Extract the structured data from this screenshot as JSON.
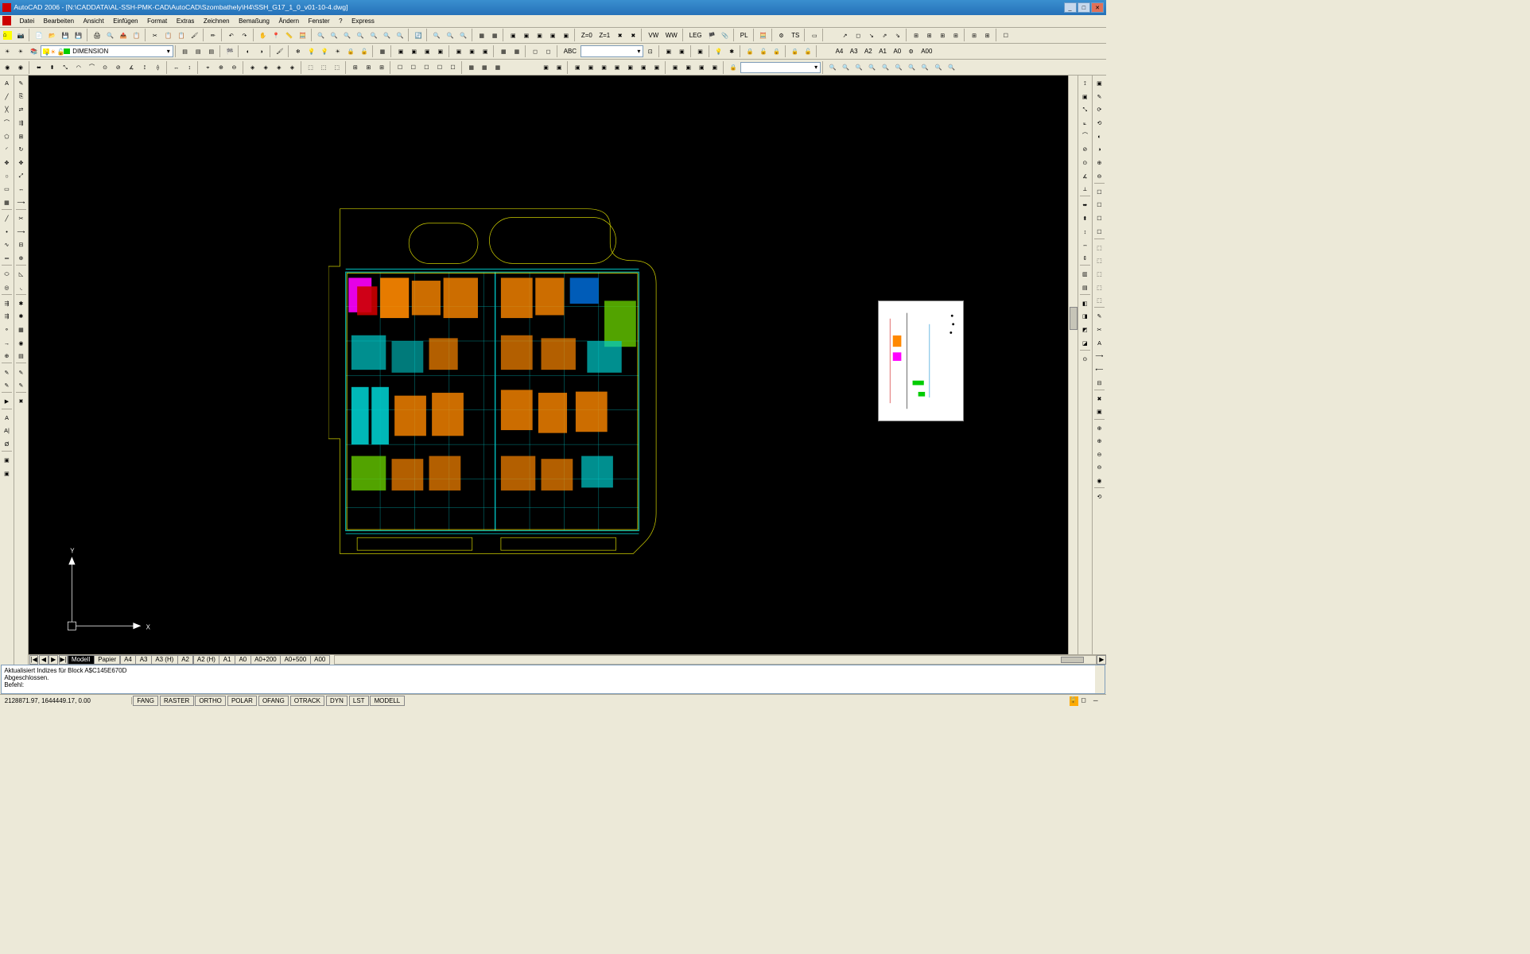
{
  "title": "AutoCAD 2006 - [N:\\CADDATA\\AL-SSH-PMK-CAD\\AutoCAD\\Szombathely\\H4\\SSH_G17_1_0_v01-10-4.dwg]",
  "menu": [
    "Datei",
    "Bearbeiten",
    "Ansicht",
    "Einfügen",
    "Format",
    "Extras",
    "Zeichnen",
    "Bemaßung",
    "Ändern",
    "Fenster",
    "?",
    "Express"
  ],
  "layer": {
    "name": "DIMENSION"
  },
  "paper_sizes": [
    "A4",
    "A3",
    "A2",
    "A1",
    "A0",
    "A00"
  ],
  "tool_text": {
    "z0": "Z=0",
    "z1": "Z=1",
    "vw": "VW",
    "ww": "WW",
    "leg": "LEG",
    "pl": "PL",
    "ts": "TS"
  },
  "tabs": {
    "nav": [
      "|◀",
      "◀",
      "▶",
      "▶|"
    ],
    "items": [
      "Modell",
      "Papier",
      "A4",
      "A3",
      "A3 (H)",
      "A2",
      "A2 (H)",
      "A1",
      "A0",
      "A0+200",
      "A0+500",
      "A00"
    ],
    "active": "Modell"
  },
  "cmd": {
    "line1": "Aktualisiert Indizes für Block A$C145E670D",
    "line2": "Abgeschlossen.",
    "prompt": "Befehl:"
  },
  "status": {
    "coords": "2128871.97, 1644449.17, 0.00",
    "modes": [
      "FANG",
      "RASTER",
      "ORTHO",
      "POLAR",
      "OFANG",
      "OTRACK",
      "DYN",
      "LST",
      "MODELL"
    ]
  },
  "ucs": {
    "y": "Y",
    "x": "X"
  }
}
